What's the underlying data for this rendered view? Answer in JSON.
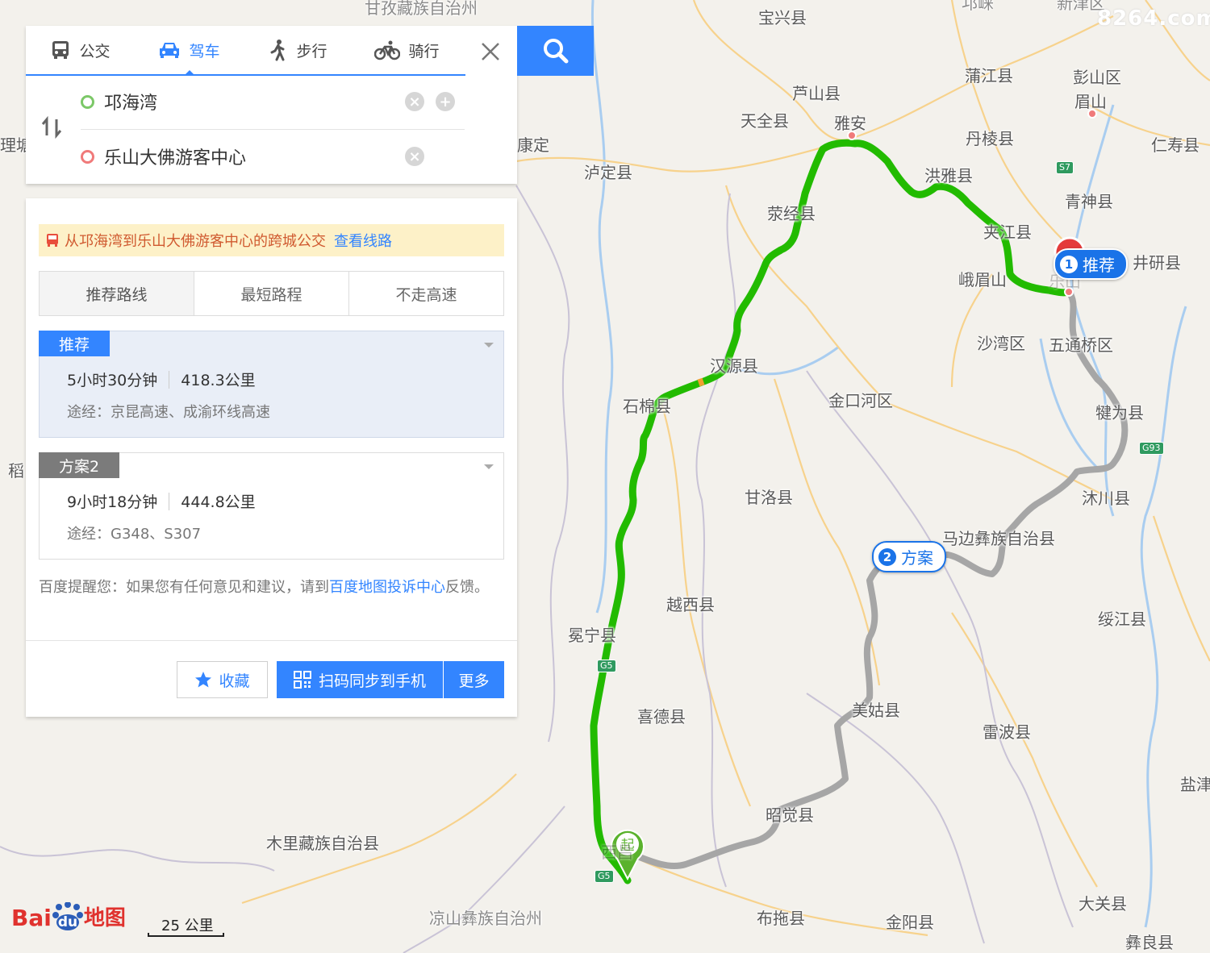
{
  "modes": [
    {
      "label": "公交",
      "icon": "bus-icon"
    },
    {
      "label": "驾车",
      "icon": "car-icon"
    },
    {
      "label": "步行",
      "icon": "walk-icon"
    },
    {
      "label": "骑行",
      "icon": "bike-icon"
    }
  ],
  "route": {
    "start": "邛海湾",
    "end": "乐山大佛游客中心"
  },
  "notice": {
    "text": "从邛海湾到乐山大佛游客中心的跨城公交",
    "link": "查看线路"
  },
  "tabs": [
    "推荐路线",
    "最短路程",
    "不走高速"
  ],
  "plans": [
    {
      "tag": "推荐",
      "time": "5小时30分钟",
      "distance": "418.3公里",
      "via": "途经：京昆高速、成渝环线高速"
    },
    {
      "tag": "方案2",
      "time": "9小时18分钟",
      "distance": "444.8公里",
      "via": "途经：G348、S307"
    }
  ],
  "tip": {
    "prefix": "百度提醒您：如果您有任何意见和建议，请到",
    "link": "百度地图投诉中心",
    "suffix": "反馈。"
  },
  "buttons": {
    "favorite": "收藏",
    "sync": "扫码同步到手机",
    "more": "更多"
  },
  "map": {
    "places": [
      {
        "name": "甘孜藏族自治州"
      },
      {
        "name": "宝兴县"
      },
      {
        "name": "邛崃"
      },
      {
        "name": "新津区"
      },
      {
        "name": "芦山县"
      },
      {
        "name": "蒲江县"
      },
      {
        "name": "彭山区"
      },
      {
        "name": "眉山"
      },
      {
        "name": "天全县"
      },
      {
        "name": "雅安"
      },
      {
        "name": "丹棱县"
      },
      {
        "name": "仁寿县"
      },
      {
        "name": "理塘"
      },
      {
        "name": "康定"
      },
      {
        "name": "泸定县"
      },
      {
        "name": "洪雅县"
      },
      {
        "name": "青神县"
      },
      {
        "name": "荥经县"
      },
      {
        "name": "夹江县"
      },
      {
        "name": "井研县"
      },
      {
        "name": "峨眉山"
      },
      {
        "name": "乐山"
      },
      {
        "name": "沙湾区"
      },
      {
        "name": "五通桥区"
      },
      {
        "name": "汉源县"
      },
      {
        "name": "金口河区"
      },
      {
        "name": "石棉县"
      },
      {
        "name": "犍为县"
      },
      {
        "name": "稻"
      },
      {
        "name": "甘洛县"
      },
      {
        "name": "沐川县"
      },
      {
        "name": "马边彝族自治县"
      },
      {
        "name": "越西县"
      },
      {
        "name": "冕宁县"
      },
      {
        "name": "绥江县"
      },
      {
        "name": "喜德县"
      },
      {
        "name": "美姑县"
      },
      {
        "name": "雷波县"
      },
      {
        "name": "盐津"
      },
      {
        "name": "昭觉县"
      },
      {
        "name": "木里藏族自治县"
      },
      {
        "name": "西昌"
      },
      {
        "name": "凉山彝族自治州"
      },
      {
        "name": "布拖县"
      },
      {
        "name": "金阳县"
      },
      {
        "name": "大关县"
      },
      {
        "name": "彝良县"
      }
    ],
    "highways": [
      "G5",
      "G5",
      "S7",
      "G93"
    ],
    "pins": {
      "recommend": {
        "num": "1",
        "label": "推荐"
      },
      "alt": {
        "num": "2",
        "label": "方案"
      },
      "start": "起"
    },
    "scale": "25 公里",
    "logo": {
      "bai": "Bai",
      "du": "du",
      "map": "地图"
    },
    "watermark": "8264.com",
    "colors": {
      "recommended_route": "#22bb00",
      "alt_route": "#b3b3b3",
      "accent": "#3385ff"
    }
  }
}
